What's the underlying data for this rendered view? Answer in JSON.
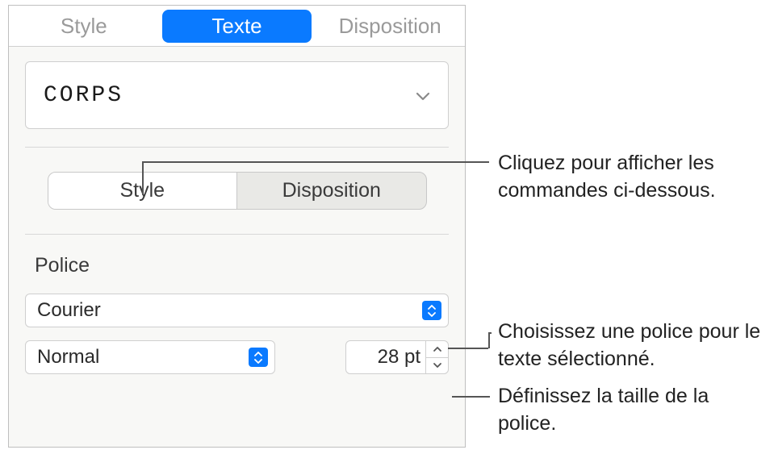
{
  "top_tabs": {
    "style": "Style",
    "texte": "Texte",
    "disposition": "Disposition"
  },
  "paragraph_style": {
    "label": "CORPS"
  },
  "segmented": {
    "style": "Style",
    "disposition": "Disposition"
  },
  "police_section": {
    "heading": "Police",
    "font": "Courier",
    "typeface": "Normal",
    "size_value": "28 pt"
  },
  "callouts": {
    "c1": "Cliquez pour afficher les commandes ci-dessous.",
    "c2": "Choisissez une police pour le texte sélectionné.",
    "c3": "Définissez la taille de la police."
  }
}
